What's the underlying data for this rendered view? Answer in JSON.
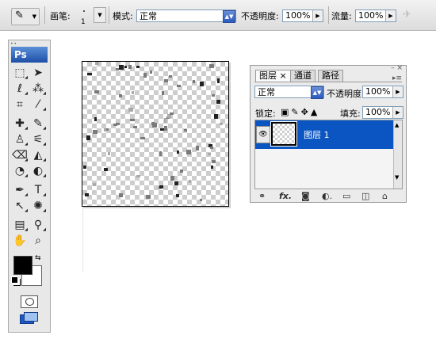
{
  "options_bar": {
    "tool_icon": "brush-icon",
    "brush_label": "画笔:",
    "brush_size": "1",
    "mode_label": "模式:",
    "mode_value": "正常",
    "opacity_label": "不透明度:",
    "opacity_value": "100%",
    "flow_label": "流量:",
    "flow_value": "100%",
    "airbrush_icon": "airbrush-icon"
  },
  "toolbox": {
    "logo": "Ps",
    "tools": [
      "rect-marquee-icon",
      "move-icon",
      "lasso-icon",
      "magic-wand-icon",
      "crop-icon",
      "slice-icon",
      "healing-brush-icon",
      "brush-icon",
      "clone-stamp-icon",
      "history-brush-icon",
      "eraser-icon",
      "paint-bucket-icon",
      "blur-icon",
      "dodge-icon",
      "pen-icon",
      "type-icon",
      "path-selection-icon",
      "custom-shape-icon",
      "notes-icon",
      "eyedropper-icon",
      "hand-icon",
      "zoom-icon"
    ],
    "foreground_color": "#000000",
    "background_color": "#ffffff"
  },
  "layers_panel": {
    "tabs": [
      {
        "label": "图层 ×",
        "active": true
      },
      {
        "label": "通道",
        "active": false
      },
      {
        "label": "路径",
        "active": false
      }
    ],
    "blend_mode": "正常",
    "opacity_label": "不透明度:",
    "opacity_value": "100%",
    "lock_label": "锁定:",
    "fill_label": "填充:",
    "fill_value": "100%",
    "layers": [
      {
        "name": "图层 1",
        "visible": true,
        "selected": true
      }
    ],
    "bottom_icons": [
      "link-icon",
      "fx-icon",
      "mask-icon",
      "adjustment-icon",
      "folder-icon",
      "new-layer-icon",
      "trash-icon"
    ],
    "selection_color": "#0a55c2"
  }
}
